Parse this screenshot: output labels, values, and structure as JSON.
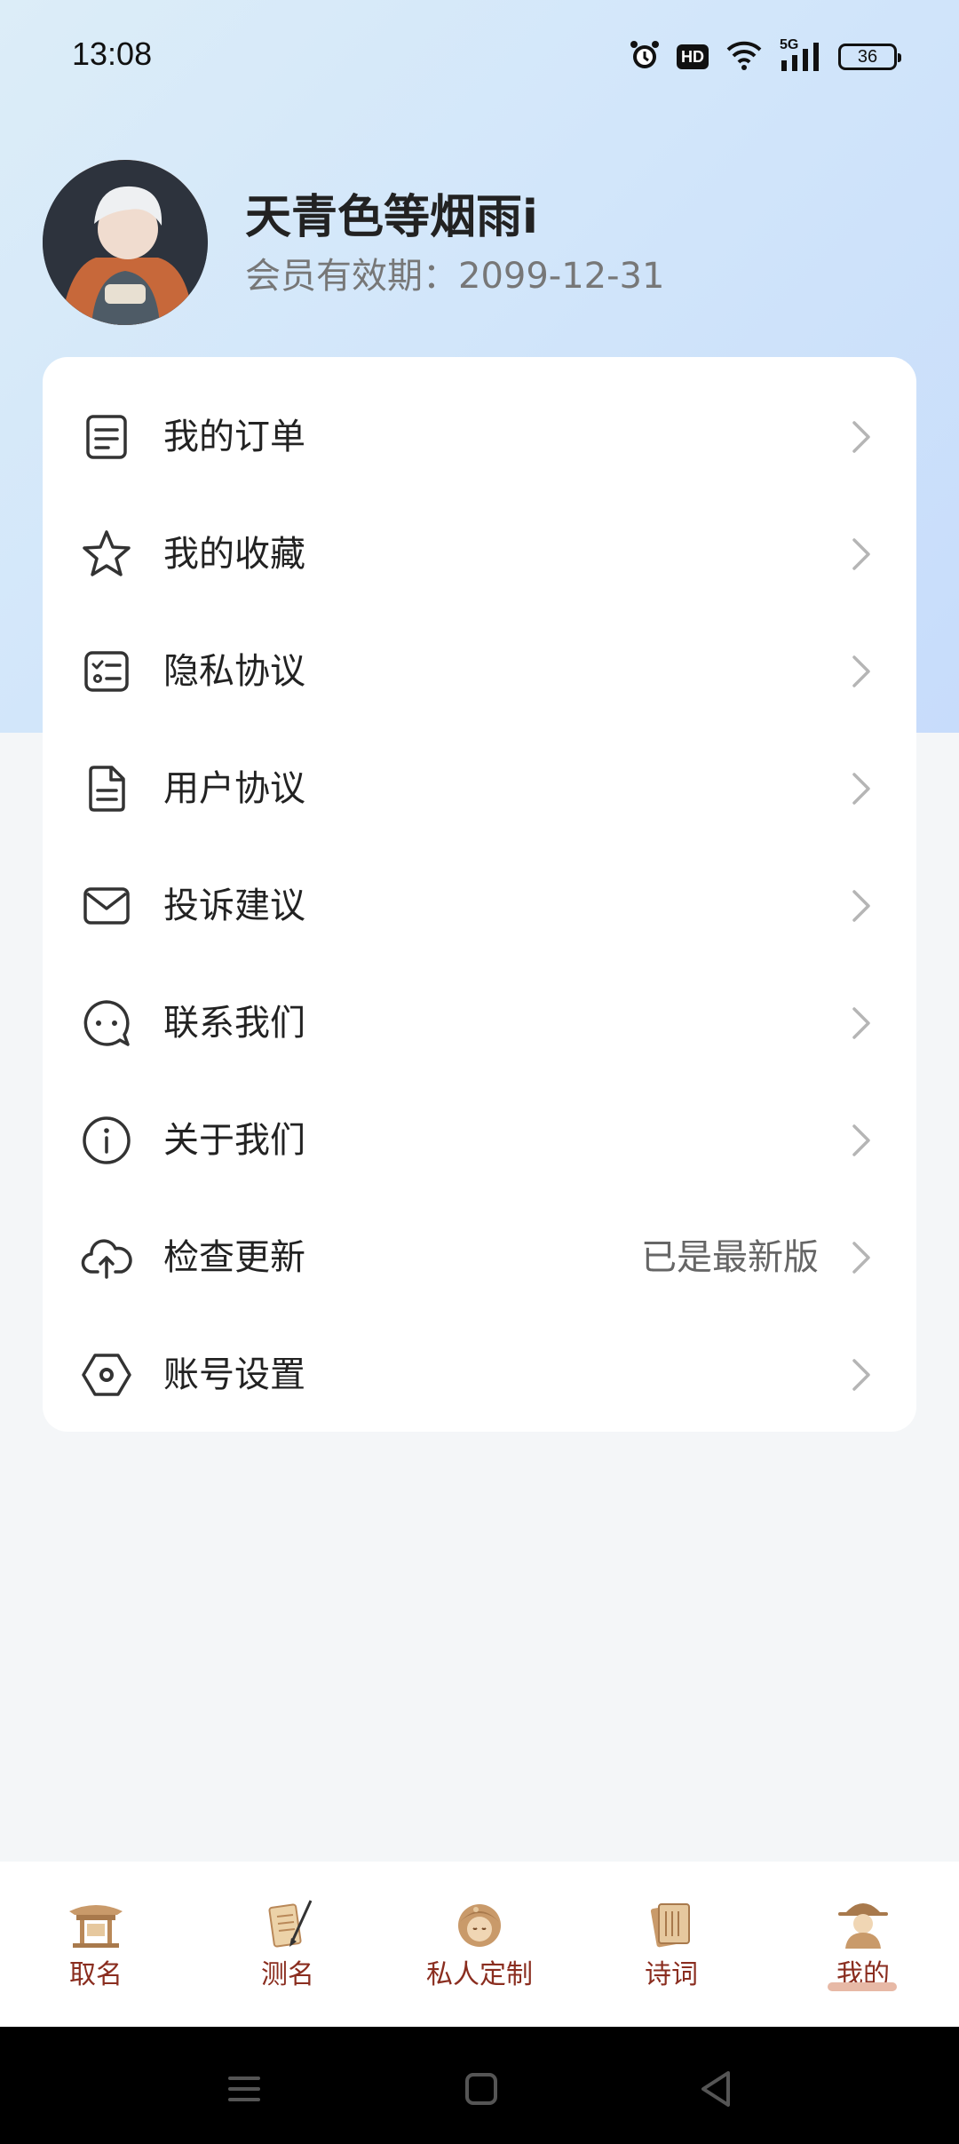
{
  "status_bar": {
    "time": "13:08",
    "hd": "HD",
    "network": "5G",
    "battery": "36"
  },
  "profile": {
    "name": "天青色等烟雨i",
    "membership": "会员有效期：2099-12-31"
  },
  "menu": {
    "items": [
      {
        "label": "我的订单",
        "icon": "order-icon"
      },
      {
        "label": "我的收藏",
        "icon": "star-icon"
      },
      {
        "label": "隐私协议",
        "icon": "checklist-icon"
      },
      {
        "label": "用户协议",
        "icon": "document-icon"
      },
      {
        "label": "投诉建议",
        "icon": "mail-icon"
      },
      {
        "label": "联系我们",
        "icon": "chat-icon"
      },
      {
        "label": "关于我们",
        "icon": "info-icon"
      },
      {
        "label": "检查更新",
        "icon": "cloud-upload-icon",
        "value": "已是最新版"
      },
      {
        "label": "账号设置",
        "icon": "settings-icon"
      }
    ]
  },
  "tab_bar": {
    "tabs": [
      {
        "label": "取名",
        "icon": "pavilion-icon"
      },
      {
        "label": "测名",
        "icon": "scroll-brush-icon"
      },
      {
        "label": "私人定制",
        "icon": "monk-icon"
      },
      {
        "label": "诗词",
        "icon": "book-icon"
      },
      {
        "label": "我的",
        "icon": "scholar-icon"
      }
    ],
    "active_index": 4,
    "active_color": "#8a2d1f"
  },
  "system_nav": {
    "buttons": [
      "menu-icon",
      "home-icon",
      "back-icon"
    ]
  }
}
